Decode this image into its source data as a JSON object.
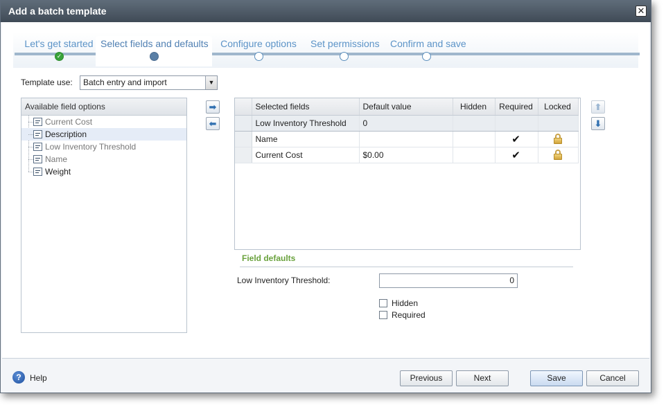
{
  "dialog": {
    "title": "Add a batch template",
    "close_symbol": "✕"
  },
  "wizard": {
    "steps": [
      {
        "label": "Let's get started",
        "state": "done"
      },
      {
        "label": "Select fields and defaults",
        "state": "current"
      },
      {
        "label": "Configure options",
        "state": "pending"
      },
      {
        "label": "Set permissions",
        "state": "pending"
      },
      {
        "label": "Confirm and save",
        "state": "pending"
      }
    ]
  },
  "template_use": {
    "label": "Template use:",
    "value": "Batch entry and import"
  },
  "available_fields": {
    "header": "Available field options",
    "items": [
      {
        "label": "Current Cost",
        "state": "disabled"
      },
      {
        "label": "Description",
        "state": "selected"
      },
      {
        "label": "Low Inventory Threshold",
        "state": "disabled"
      },
      {
        "label": "Name",
        "state": "disabled"
      },
      {
        "label": "Weight",
        "state": "enabled"
      }
    ]
  },
  "selected_fields": {
    "columns": [
      "Selected fields",
      "Default value",
      "Hidden",
      "Required",
      "Locked"
    ],
    "rows": [
      {
        "field": "Low Inventory Threshold",
        "default": "0",
        "hidden": false,
        "required": false,
        "locked": false
      },
      {
        "field": "Name",
        "default": "",
        "hidden": false,
        "required": true,
        "locked": true
      },
      {
        "field": "Current Cost",
        "default": "$0.00",
        "hidden": false,
        "required": true,
        "locked": true
      }
    ]
  },
  "field_defaults": {
    "title": "Field defaults",
    "field_label": "Low Inventory Threshold:",
    "field_value": "0",
    "hidden_label": "Hidden",
    "required_label": "Required"
  },
  "footer": {
    "help_label": "Help",
    "previous_label": "Previous",
    "next_label": "Next",
    "save_label": "Save",
    "cancel_label": "Cancel"
  },
  "icons": {
    "checkmark": "✔",
    "help": "?",
    "dropdown": "▼",
    "arrow_right": "➡",
    "arrow_left": "⬅",
    "arrow_up": "⬆",
    "arrow_down": "⬇",
    "step_done": "✓"
  }
}
